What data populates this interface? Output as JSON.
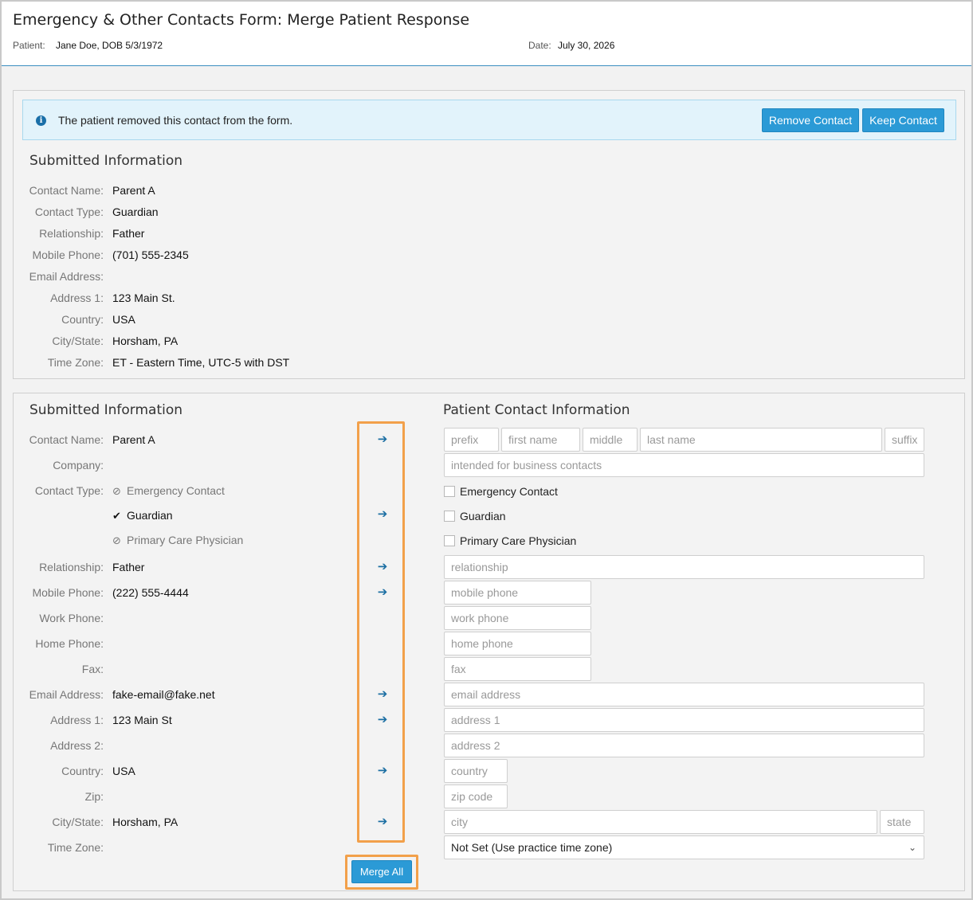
{
  "header": {
    "title": "Emergency & Other Contacts Form: Merge Patient Response",
    "patient_label": "Patient:",
    "patient_value": "Jane Doe, DOB 5/3/1972",
    "date_label": "Date:",
    "date_value": "July 30, 2026"
  },
  "alert": {
    "icon": "info-icon",
    "message": "The patient removed this contact from the form.",
    "remove_label": "Remove Contact",
    "keep_label": "Keep Contact"
  },
  "removed_contact": {
    "title": "Submitted Information",
    "fields": [
      {
        "label": "Contact Name:",
        "value": "Parent A"
      },
      {
        "label": "Contact Type:",
        "value": "Guardian"
      },
      {
        "label": "Relationship:",
        "value": "Father"
      },
      {
        "label": "Mobile Phone:",
        "value": "(701) 555-2345"
      },
      {
        "label": "Email Address:",
        "value": ""
      },
      {
        "label": "Address 1:",
        "value": "123 Main St."
      },
      {
        "label": "Country:",
        "value": "USA"
      },
      {
        "label": "City/State:",
        "value": "Horsham, PA"
      },
      {
        "label": "Time Zone:",
        "value": "ET - Eastern Time, UTC-5 with DST"
      }
    ]
  },
  "merge": {
    "submitted_title": "Submitted Information",
    "patient_title": "Patient Contact Information",
    "labels": {
      "contact_name": "Contact Name:",
      "company": "Company:",
      "contact_type": "Contact Type:",
      "relationship": "Relationship:",
      "mobile_phone": "Mobile Phone:",
      "work_phone": "Work Phone:",
      "home_phone": "Home Phone:",
      "fax": "Fax:",
      "email": "Email Address:",
      "address1": "Address 1:",
      "address2": "Address 2:",
      "country": "Country:",
      "zip": "Zip:",
      "city_state": "City/State:",
      "time_zone": "Time Zone:"
    },
    "submitted": {
      "contact_name": "Parent A",
      "contact_types": [
        {
          "label": "Emergency Contact",
          "state": "not-selected",
          "icon": "ban-icon"
        },
        {
          "label": "Guardian",
          "state": "selected",
          "icon": "check-icon"
        },
        {
          "label": "Primary Care Physician",
          "state": "not-selected",
          "icon": "ban-icon"
        }
      ],
      "relationship": "Father",
      "mobile_phone": "(222) 555-4444",
      "email": "fake-email@fake.net",
      "address1": "123 Main St",
      "country": "USA",
      "city_state": "Horsham, PA"
    },
    "placeholders": {
      "prefix": "prefix",
      "first_name": "first name",
      "middle": "middle",
      "last_name": "last name",
      "suffix": "suffix",
      "company": "intended for business contacts",
      "relationship": "relationship",
      "mobile_phone": "mobile phone",
      "work_phone": "work phone",
      "home_phone": "home phone",
      "fax": "fax",
      "email": "email address",
      "address1": "address 1",
      "address2": "address 2",
      "country": "country",
      "zip": "zip code",
      "city": "city",
      "state": "state"
    },
    "checkboxes": [
      {
        "label": "Emergency Contact",
        "checked": false
      },
      {
        "label": "Guardian",
        "checked": false
      },
      {
        "label": "Primary Care Physician",
        "checked": false
      }
    ],
    "time_zone_value": "Not Set (Use practice time zone)",
    "merge_all_label": "Merge All",
    "arrow_icon": "arrow-right-icon",
    "highlight_color": "#f2a04a"
  },
  "colors": {
    "accent": "#2b9ad6",
    "alert_bg": "#e2f3fb",
    "arrow": "#1c6fa3"
  }
}
